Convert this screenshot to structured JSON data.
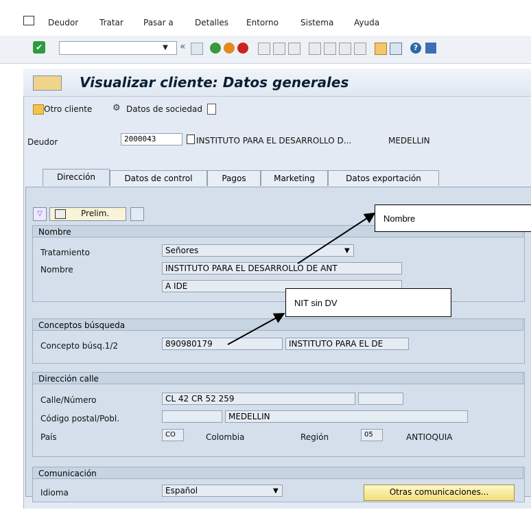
{
  "menu": [
    "Deudor",
    "Tratar",
    "Pasar a",
    "Detalles",
    "Entorno",
    "Sistema",
    "Ayuda"
  ],
  "window_title": "Visualizar cliente: Datos generales",
  "app_toolbar": {
    "otro_cliente": "Otro cliente",
    "datos_sociedad": "Datos de sociedad"
  },
  "header": {
    "deudor_label": "Deudor",
    "deudor_value": "2000043",
    "deudor_name": "INSTITUTO PARA EL DESARROLLO D...",
    "deudor_city": "MEDELLIN"
  },
  "tabs": [
    "Dirección",
    "Datos de control",
    "Pagos",
    "Marketing",
    "Datos exportación"
  ],
  "toolbar2": {
    "prelim": "Prelim."
  },
  "nombre_group": {
    "title": "Nombre",
    "tratamiento_label": "Tratamiento",
    "tratamiento_value": "Señores",
    "nombre_label": "Nombre",
    "nombre1": "INSTITUTO PARA EL DESARROLLO DE ANT",
    "nombre2": "A IDE"
  },
  "conceptos_group": {
    "title": "Conceptos búsqueda",
    "concepto_label": "Concepto búsq.1/2",
    "concepto1": "890980179",
    "concepto2": "INSTITUTO PARA EL DE"
  },
  "direccion_group": {
    "title": "Dirección calle",
    "calle_label": "Calle/Número",
    "calle_value": "CL 42 CR 52 259",
    "cp_label": "Código postal/Pobl.",
    "poblacion": "MEDELLIN",
    "pais_label": "País",
    "pais_code": "CO",
    "pais_name": "Colombia",
    "region_label": "Región",
    "region_code": "05",
    "region_name": "ANTIOQUIA"
  },
  "comunicacion_group": {
    "title": "Comunicación",
    "idioma_label": "Idioma",
    "idioma_value": "Español",
    "otras_btn": "Otras comunicaciones..."
  },
  "callouts": {
    "nombre": "Nombre",
    "nit": "NIT sin DV"
  }
}
